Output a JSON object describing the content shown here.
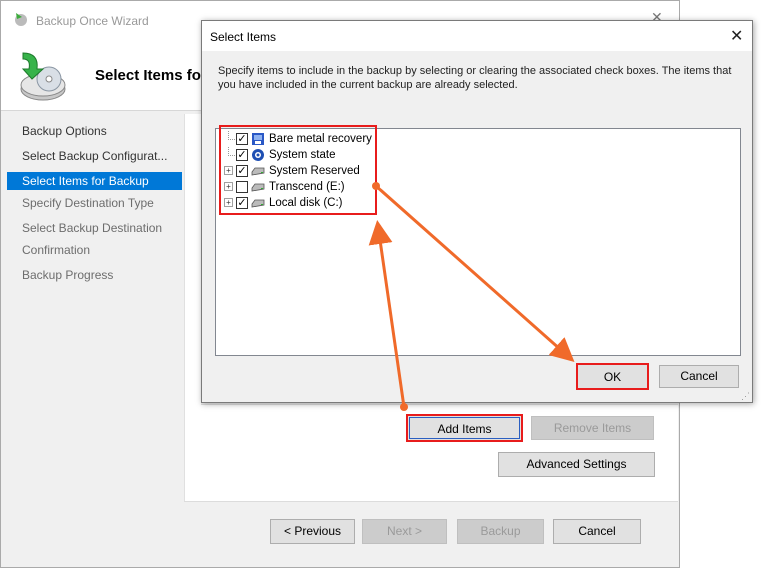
{
  "wizard": {
    "title": "Backup Once Wizard",
    "header_title": "Select Items for Backup",
    "nav": [
      {
        "label": "Backup Options",
        "state": "done"
      },
      {
        "label": "Select Backup Configurat...",
        "state": "done"
      },
      {
        "label": "Select Items for Backup",
        "state": "active"
      },
      {
        "label": "Specify Destination Type",
        "state": "disabled"
      },
      {
        "label": "Select Backup Destination",
        "state": "disabled"
      },
      {
        "label": "Confirmation",
        "state": "disabled"
      },
      {
        "label": "Backup Progress",
        "state": "disabled"
      }
    ],
    "buttons": {
      "add_items": "Add Items",
      "remove_items": "Remove Items",
      "advanced_settings": "Advanced Settings",
      "previous": "< Previous",
      "next": "Next >",
      "backup": "Backup",
      "cancel": "Cancel"
    }
  },
  "dialog": {
    "title": "Select Items",
    "close_glyph": "✕",
    "description": "Specify items to include in the backup by selecting or clearing the associated check boxes. The items that you have included in the current backup are already selected.",
    "items": [
      {
        "label": "Bare metal recovery",
        "checked": true,
        "expandable": false,
        "icon": "bare-metal-icon"
      },
      {
        "label": "System state",
        "checked": true,
        "expandable": false,
        "icon": "system-state-icon"
      },
      {
        "label": "System Reserved",
        "checked": true,
        "expandable": true,
        "icon": "drive-icon"
      },
      {
        "label": "Transcend (E:)",
        "checked": false,
        "expandable": true,
        "icon": "drive-icon"
      },
      {
        "label": "Local disk (C:)",
        "checked": true,
        "expandable": true,
        "icon": "drive-icon"
      }
    ],
    "ok_label": "OK",
    "cancel_label": "Cancel"
  },
  "colors": {
    "highlight": "#e81c1c",
    "arrow": "#f06a2a",
    "selection": "#0078d7"
  }
}
